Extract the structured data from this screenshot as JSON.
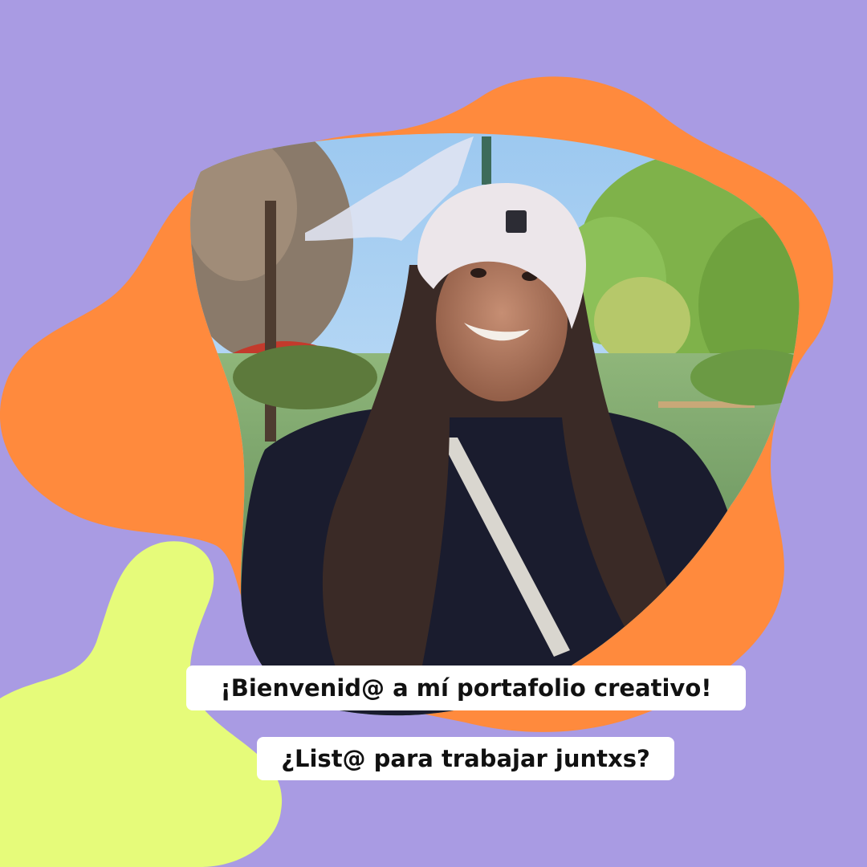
{
  "colors": {
    "background": "#a99be3",
    "accent_orange": "#ff8a3d",
    "accent_yellow": "#e6fb7a",
    "caption_background": "#ffffff",
    "caption_text": "#111111"
  },
  "photo": {
    "subject": "smiling woman with long dark hair wearing a light beanie and dark jacket in a park with trees, a pond and a red bridge"
  },
  "captions": {
    "welcome": "¡Bienvenid@ a mí portafolio creativo!",
    "question": "¿List@ para trabajar juntxs?"
  }
}
